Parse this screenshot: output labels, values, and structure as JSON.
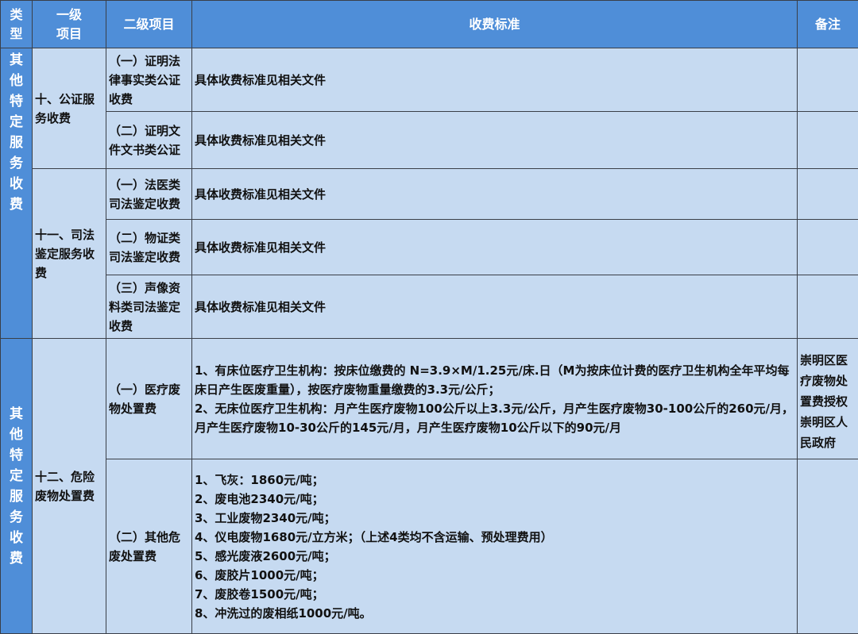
{
  "header": {
    "type": "类型",
    "level1": "一级项目",
    "level1_lines": [
      "一级",
      "项目"
    ],
    "level2": "二级项目",
    "standard": "收费标准",
    "note": "备注",
    "type_lines": [
      "类",
      "型"
    ]
  },
  "groups": [
    {
      "type_label": "其他特定服务收费",
      "type_chars": [
        "其",
        "他",
        "特",
        "定",
        "服",
        "务",
        "收",
        "费"
      ],
      "sections": [
        {
          "level1": "十、公证服务收费",
          "items": [
            {
              "level2": "（一）证明法律事实类公证收费",
              "standard": "具体收费标准见相关文件",
              "note": ""
            },
            {
              "level2": "（二）证明文件文书类公证",
              "standard": "具体收费标准见相关文件",
              "note": ""
            }
          ]
        },
        {
          "level1": "十一、司法鉴定服务收费",
          "items": [
            {
              "level2": "（一）法医类司法鉴定收费",
              "standard": "具体收费标准见相关文件",
              "note": ""
            },
            {
              "level2": "（二）物证类司法鉴定收费",
              "standard": "具体收费标准见相关文件",
              "note": ""
            },
            {
              "level2": "（三）声像资料类司法鉴定收费",
              "standard": "具体收费标准见相关文件",
              "note": ""
            }
          ]
        }
      ]
    },
    {
      "type_label": "其他特定服务收费",
      "type_chars": [
        "其",
        "他",
        "特",
        "定",
        "服",
        "务",
        "收",
        "费"
      ],
      "sections": [
        {
          "level1": "十二、危险废物处置费",
          "items": [
            {
              "level2": "（一）医疗废物处置费",
              "standard_lines": [
                "1、有床位医疗卫生机构：按床位缴费的 N=3.9×M/1.25元/床.日（M为按床位计费的医疗卫生机构全年平均每床日产生医废重量），按医疗废物重量缴费的3.3元/公斤；",
                "2、无床位医疗卫生机构：月产生医疗废物100公斤以上3.3元/公斤，月产生医疗废物30-100公斤的260元/月，月产生医疗废物10-30公斤的145元/月，月产生医疗废物10公斤以下的90元/月"
              ],
              "note": "崇明区医疗废物处置费授权崇明区人民政府"
            },
            {
              "level2": "（二）其他危废处置费",
              "standard_lines": [
                "1、飞灰：1860元/吨；",
                "2、废电池2340元/吨；",
                "3、工业废物2340元/吨；",
                "4、仪电废物1680元/立方米；（上述4类均不含运输、预处理费用）",
                "5、感光废液2600元/吨；",
                "6、废胶片1000元/吨；",
                "7、废胶卷1500元/吨；",
                "8、冲洗过的废相纸1000元/吨。"
              ],
              "note": ""
            }
          ]
        }
      ]
    }
  ]
}
